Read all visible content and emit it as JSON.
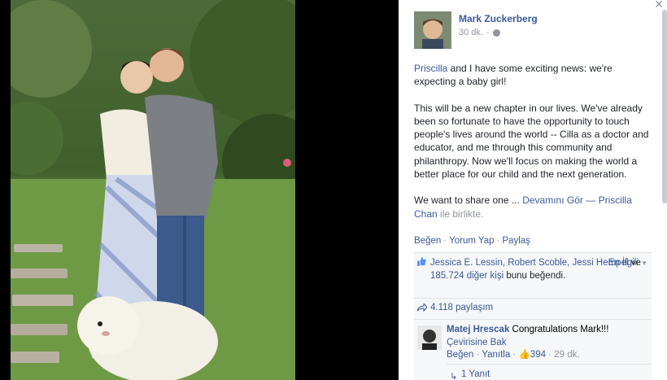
{
  "post": {
    "author": "Mark Zuckerberg",
    "time": "30 dk.",
    "tagged_first": "Priscilla",
    "para1_rest": " and I have some exciting news: we're expecting a baby girl!",
    "para2": "This will be a new chapter in our lives. We've already been so fortunate to have the opportunity to touch people's lives around the world -- Cilla as a doctor and educator, and me through this community and philanthropy. Now we'll focus on making the world a better place for our child and the next generation.",
    "para3_start": "We want to share one ...",
    "see_more": " Devamını Gör",
    "dash": " — ",
    "with_name": "Priscilla Chan",
    "with_suffix": " ile birlikte."
  },
  "actions": {
    "like": "Beğen",
    "comment": "Yorum Yap",
    "share": "Paylaş"
  },
  "ufi": {
    "likers": "Jessica E. Lessin, Robert Scoble, Jessi Hempel",
    "likes_mid": " ve ",
    "others": "185.724 diğer kişi",
    "likes_end": " bunu beğendi.",
    "most_relevant": "En İlgili",
    "shares": "4.118 paylaşım"
  },
  "comment": {
    "name": "Matej Hrescak",
    "text": " Congratulations Mark!!!",
    "see_translation": "Çevirisine Bak",
    "like": "Beğen",
    "reply": "Yanıtla",
    "likes": "394",
    "time": "29 dk.",
    "replies": "1 Yanıt"
  }
}
